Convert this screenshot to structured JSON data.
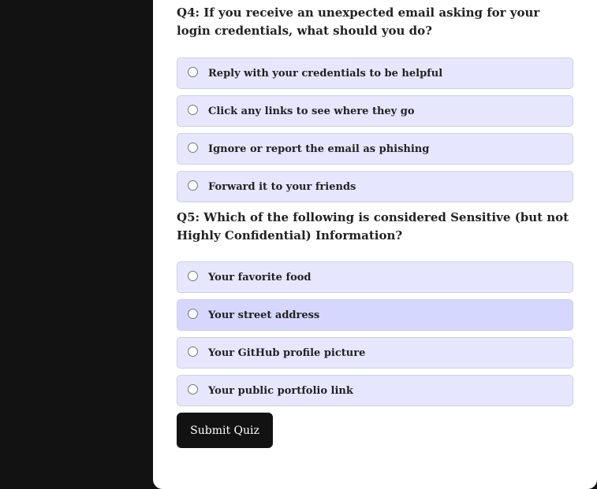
{
  "questions": [
    {
      "text": "Q4: If you receive an unexpected email asking for your login credentials, what should you do?",
      "options": [
        "Reply with your credentials to be helpful",
        "Click any links to see where they go",
        "Ignore or report the email as phishing",
        "Forward it to your friends"
      ]
    },
    {
      "text": "Q5: Which of the following is considered Sensitive (but not Highly Confidential) Information?",
      "options": [
        "Your favorite food",
        "Your street address",
        "Your GitHub profile picture",
        "Your public portfolio link"
      ]
    }
  ],
  "submit_label": "Submit Quiz"
}
